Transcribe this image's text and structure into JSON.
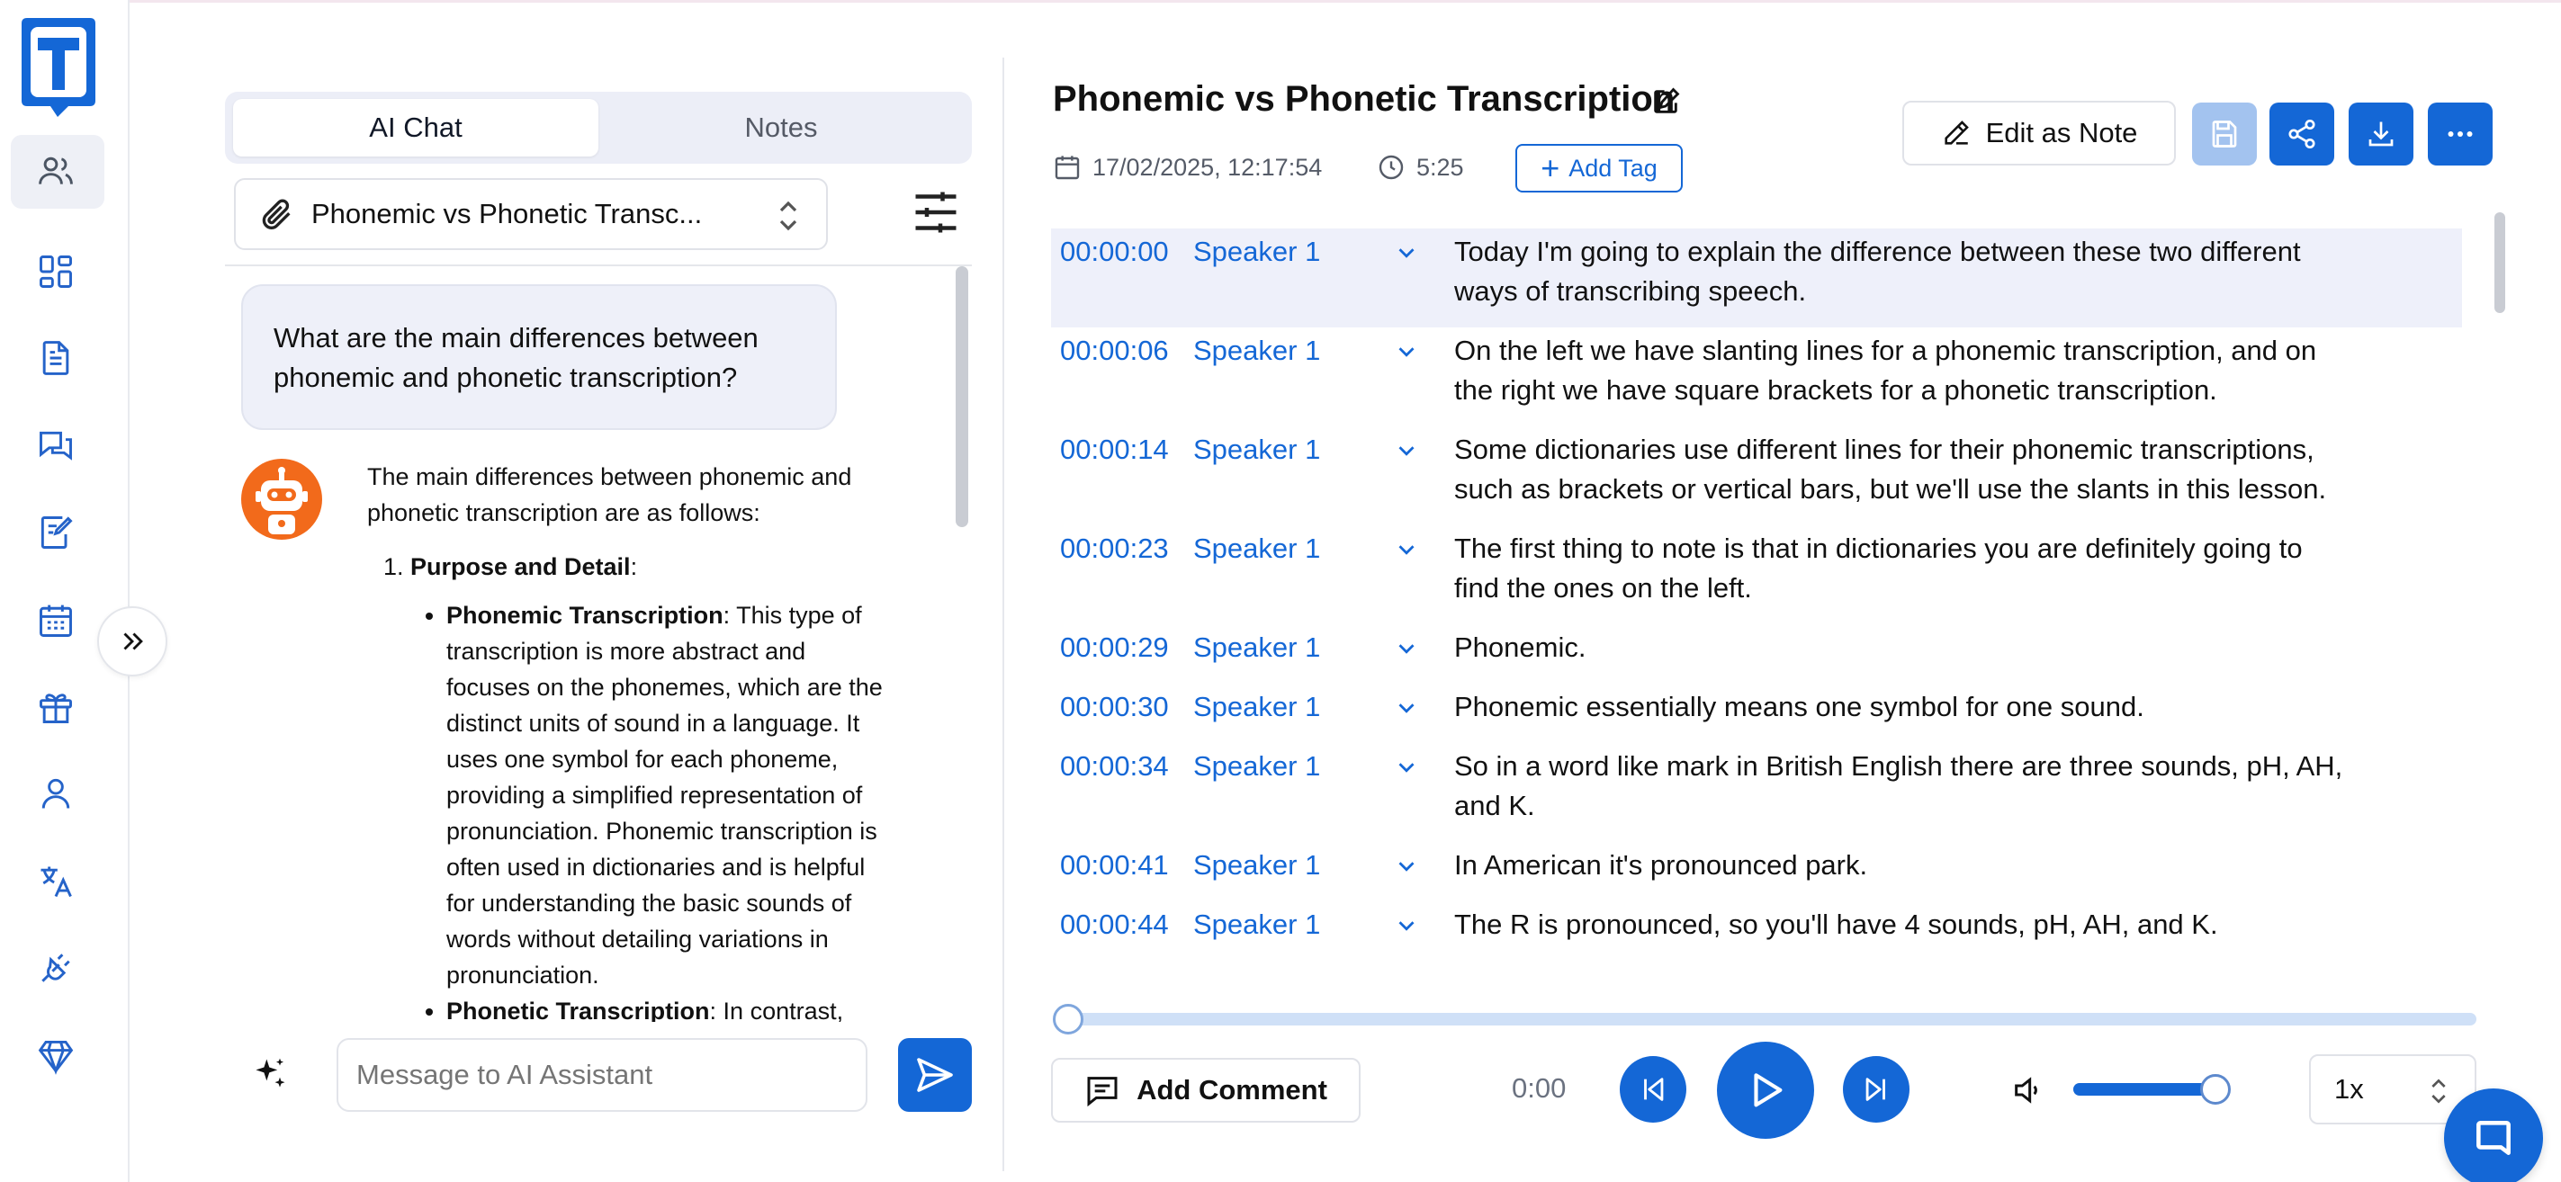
{
  "chat_panel": {
    "tabs": [
      {
        "label": "AI Chat",
        "active": true
      },
      {
        "label": "Notes",
        "active": false
      }
    ],
    "file_select": {
      "value": "Phonemic vs Phonetic Transc..."
    },
    "user_message": "What are the main differences between phonemic and phonetic transcription?",
    "assistant_message": {
      "intro": "The main differences between phonemic and phonetic transcription are as follows:",
      "list_heading": "Purpose and Detail",
      "list_heading_suffix": ":",
      "bullets": [
        {
          "term": "Phonemic Transcription",
          "text": ": This type of transcription is more abstract and focuses on the phonemes, which are the distinct units of sound in a language. It uses one symbol for each phoneme, providing a simplified representation of pronunciation. Phonemic transcription is often used in dictionaries and is helpful for understanding the basic sounds of words without detailing variations in pronunciation."
        },
        {
          "term": "Phonetic Transcription",
          "text": ": In contrast,"
        }
      ]
    },
    "input": {
      "placeholder": "Message to AI Assistant",
      "value": ""
    }
  },
  "document": {
    "title": "Phonemic vs Phonetic Transcription",
    "date": "17/02/2025, 12:17:54",
    "duration": "5:25",
    "add_tag_label": "Add Tag",
    "edit_as_note_label": "Edit as Note"
  },
  "transcript": [
    {
      "time": "00:00:00",
      "speaker": "Speaker 1",
      "lines": [
        "Today I'm going to explain the difference between these two different",
        "ways of transcribing speech."
      ],
      "highlighted": true
    },
    {
      "time": "00:00:06",
      "speaker": "Speaker 1",
      "lines": [
        "On the left we have slanting lines for a phonemic transcription, and on",
        "the right we have square brackets for a phonetic transcription."
      ]
    },
    {
      "time": "00:00:14",
      "speaker": "Speaker 1",
      "lines": [
        "Some dictionaries use different lines for their phonemic transcriptions,",
        "such as brackets or vertical bars, but we'll use the slants in this lesson."
      ]
    },
    {
      "time": "00:00:23",
      "speaker": "Speaker 1",
      "lines": [
        "The first thing to note is that in dictionaries you are definitely going to",
        "find the ones on the left."
      ]
    },
    {
      "time": "00:00:29",
      "speaker": "Speaker 1",
      "lines": [
        "Phonemic."
      ]
    },
    {
      "time": "00:00:30",
      "speaker": "Speaker 1",
      "lines": [
        "Phonemic essentially means one symbol for one sound."
      ]
    },
    {
      "time": "00:00:34",
      "speaker": "Speaker 1",
      "lines": [
        "So in a word like mark in British English there are three sounds, pH, AH,",
        "and K."
      ]
    },
    {
      "time": "00:00:41",
      "speaker": "Speaker 1",
      "lines": [
        "In American it's pronounced park."
      ]
    },
    {
      "time": "00:00:44",
      "speaker": "Speaker 1",
      "lines": [
        "The R is pronounced, so you'll have 4 sounds, pH, AH, and K."
      ]
    }
  ],
  "player": {
    "add_comment_label": "Add Comment",
    "current_time": "0:00",
    "progress": 0,
    "volume": 1.0,
    "speed": "1x"
  },
  "colors": {
    "accent": "#1467d6",
    "accent_disabled": "#a3c3ef",
    "highlight_row": "#eef0fa",
    "bot_avatar": "#f26a1b"
  },
  "icons": {
    "nav": [
      "users-icon",
      "dashboard-icon",
      "document-icon",
      "chat-icon",
      "notebook-edit-icon",
      "calendar-icon",
      "gift-icon",
      "user-icon",
      "translate-icon",
      "plug-icon",
      "diamond-icon"
    ],
    "actions": [
      "save-icon",
      "share-icon",
      "download-icon",
      "more-icon"
    ]
  }
}
